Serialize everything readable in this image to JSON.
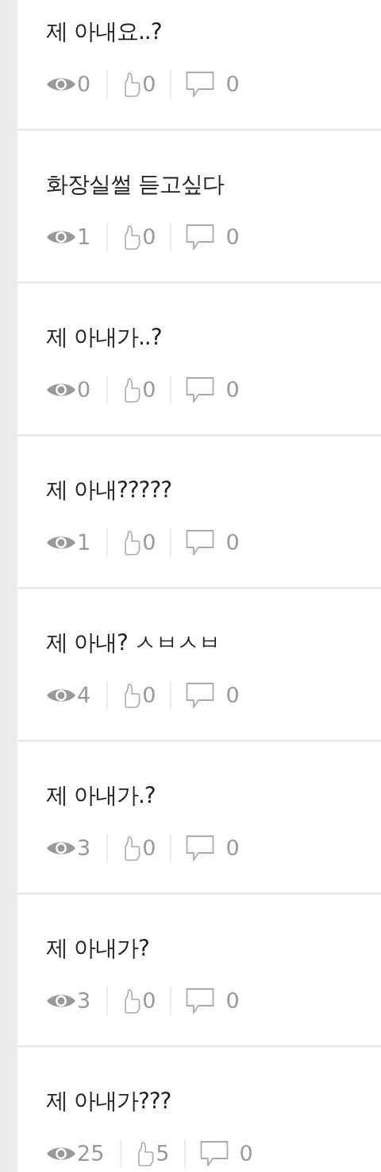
{
  "posts": [
    {
      "title": "제 아내요..?",
      "views": "0",
      "likes": "0",
      "comments": "0"
    },
    {
      "title": "화장실썰 듣고싶다",
      "views": "1",
      "likes": "0",
      "comments": "0"
    },
    {
      "title": "제 아내가..?",
      "views": "0",
      "likes": "0",
      "comments": "0"
    },
    {
      "title": "제 아내?????",
      "views": "1",
      "likes": "0",
      "comments": "0"
    },
    {
      "title": "제 아내? ㅅㅂㅅㅂ",
      "views": "4",
      "likes": "0",
      "comments": "0"
    },
    {
      "title": "제 아내가.?",
      "views": "3",
      "likes": "0",
      "comments": "0"
    },
    {
      "title": "제 아내가?",
      "views": "3",
      "likes": "0",
      "comments": "0"
    },
    {
      "title": "제 아내가???",
      "views": "25",
      "likes": "5",
      "comments": "0"
    }
  ]
}
